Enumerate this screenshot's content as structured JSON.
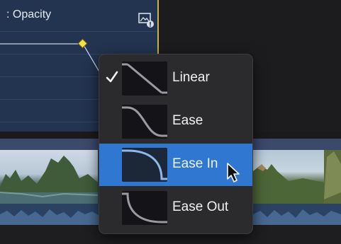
{
  "editor": {
    "title": ": Opacity",
    "icon": "image-info-icon",
    "keyframe_color": "#f2e04a"
  },
  "interpolation_menu": {
    "items": [
      {
        "label": "Linear",
        "checked": true,
        "selected": false,
        "icon": "linear-curve-icon"
      },
      {
        "label": "Ease",
        "checked": false,
        "selected": false,
        "icon": "ease-curve-icon"
      },
      {
        "label": "Ease In",
        "checked": false,
        "selected": true,
        "icon": "ease-in-curve-icon"
      },
      {
        "label": "Ease Out",
        "checked": false,
        "selected": false,
        "icon": "ease-out-curve-icon"
      }
    ],
    "highlight_color": "#2f77d0"
  },
  "cursor": {
    "icon": "mouse-pointer-icon"
  }
}
